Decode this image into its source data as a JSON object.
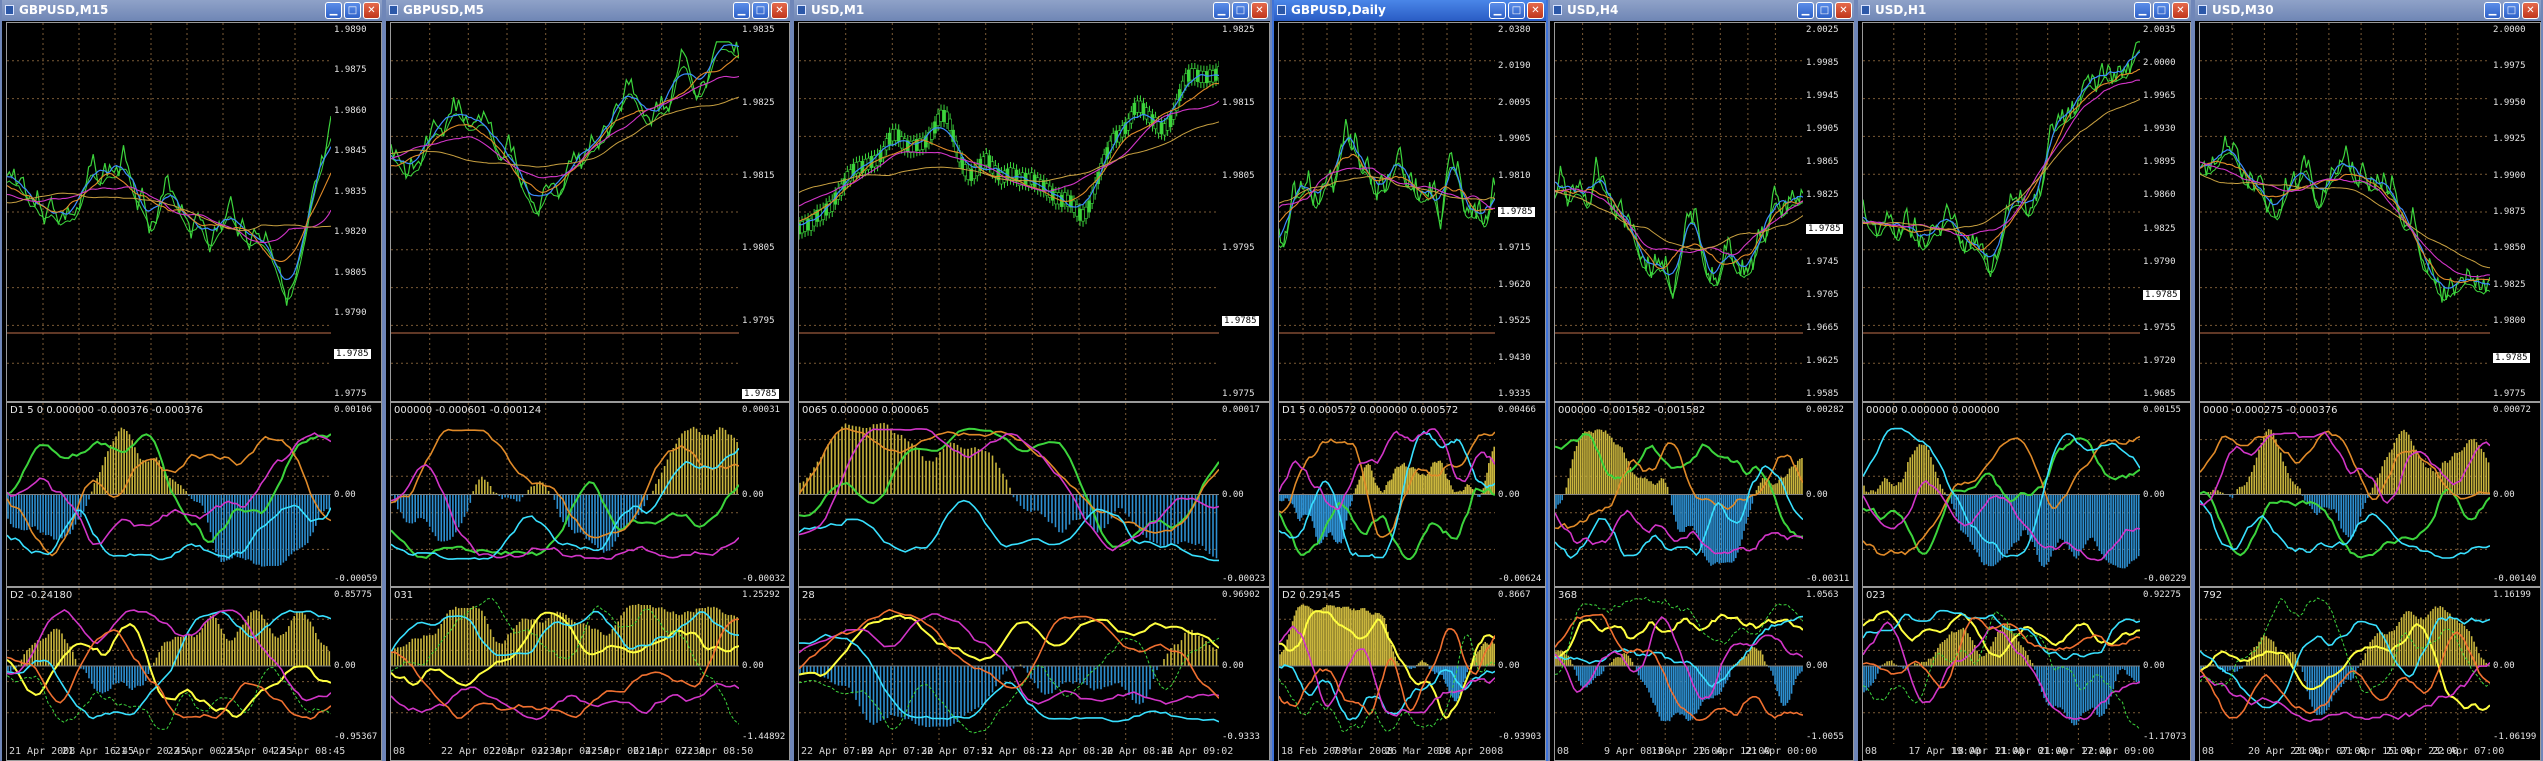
{
  "colors": {
    "title_active": "#2a5cc4",
    "title_inactive": "#7088b8",
    "grid": "#7a5a36",
    "line_green": "#3cd43c",
    "line_magenta": "#d235c8",
    "line_orange": "#e08a28",
    "line_blue": "#3c8cff",
    "line_cyan": "#38e0ff",
    "line_yellow": "#ffff40",
    "hist_olive": "#c9b53d",
    "hist_blue": "#2d8fd1"
  },
  "title_buttons": {
    "minimize": "▁",
    "maximize": "□",
    "close": "✕"
  },
  "windows": [
    {
      "title": "GBPUSD,M15",
      "active": false,
      "main_prices": [
        "1.9890",
        "1.9875",
        "1.9860",
        "1.9845",
        "1.9835",
        "1.9820",
        "1.9805",
        "1.9790",
        "1.9785",
        "1.9775"
      ],
      "mid_label": "D1 5 0 0.000000 -0.000376 -0.000376",
      "mid_prices": [
        "0.00106",
        "0.00",
        "-0.00059"
      ],
      "low_label": "D2 -0.24180",
      "low_prices": [
        "0.85775",
        "0.00",
        "-0.95367"
      ],
      "time_labels": [
        "21 Apr 2008",
        "21 Apr 16:45",
        "21 Apr 20:45",
        "22 Apr 00:45",
        "22 Apr 04:45",
        "22 Apr 08:45"
      ]
    },
    {
      "title": "GBPUSD,M5",
      "active": false,
      "main_prices": [
        "1.9835",
        "1.9825",
        "1.9815",
        "1.9805",
        "1.9795",
        "1.9785"
      ],
      "mid_label": "000000 -0.000601 -0.000124",
      "mid_prices": [
        "0.00031",
        "0.00",
        "-0.00032"
      ],
      "low_label": "031",
      "low_prices": [
        "1.25292",
        "0.00",
        "-1.44892"
      ],
      "time_labels": [
        "08",
        "22 Apr 02:05",
        "22 Apr 03:30",
        "22 Apr 04:50",
        "22 Apr 06:10",
        "22 Apr 07:30",
        "22 Apr 08:50"
      ]
    },
    {
      "title": "USD,M1",
      "active": false,
      "main_prices": [
        "1.9825",
        "1.9815",
        "1.9805",
        "1.9795",
        "1.9785",
        "1.9775"
      ],
      "mid_label": "0065 0.000000 0.000065",
      "mid_prices": [
        "0.00017",
        "0.00",
        "-0.00023"
      ],
      "low_label": "28",
      "low_prices": [
        "0.96902",
        "0.00",
        "-0.9333"
      ],
      "time_labels": [
        "22 Apr 07:09",
        "22 Apr 07:30",
        "22 Apr 07:51",
        "22 Apr 08:13",
        "22 Apr 08:30",
        "22 Apr 08:46",
        "22 Apr 09:02"
      ]
    },
    {
      "title": "GBPUSD,Daily",
      "active": true,
      "main_prices": [
        "2.0380",
        "2.0190",
        "2.0095",
        "1.9905",
        "1.9810",
        "1.9785",
        "1.9715",
        "1.9620",
        "1.9525",
        "1.9430",
        "1.9335"
      ],
      "mid_label": "D1 5 0.000572 0.000000 0.000572",
      "mid_prices": [
        "0.00466",
        "0.00",
        "-0.00624"
      ],
      "low_label": "D2 0.29145",
      "low_prices": [
        "0.8667",
        "0.00",
        "-0.93903"
      ],
      "time_labels": [
        "18 Feb 2008",
        "7 Mar 2008",
        "26 Mar 2008",
        "14 Apr 2008"
      ]
    },
    {
      "title": "USD,H4",
      "active": false,
      "main_prices": [
        "2.0025",
        "1.9985",
        "1.9945",
        "1.9905",
        "1.9865",
        "1.9825",
        "1.9785",
        "1.9745",
        "1.9705",
        "1.9665",
        "1.9625",
        "1.9585"
      ],
      "mid_label": "000000 -0.001582 -0.001582",
      "mid_prices": [
        "0.00282",
        "0.00",
        "-0.00311"
      ],
      "low_label": "368",
      "low_prices": [
        "1.0563",
        "0.00",
        "-1.0055"
      ],
      "time_labels": [
        "08",
        "9 Apr 08:00",
        "13 Apr 22:00",
        "16 Apr 12:00",
        "21 Apr 00:00"
      ]
    },
    {
      "title": "USD,H1",
      "active": false,
      "main_prices": [
        "2.0035",
        "2.0000",
        "1.9965",
        "1.9930",
        "1.9895",
        "1.9860",
        "1.9825",
        "1.9790",
        "1.9785",
        "1.9755",
        "1.9720",
        "1.9685"
      ],
      "mid_label": "00000 0.000000 0.000000",
      "mid_prices": [
        "0.00155",
        "0.00",
        "-0.00229"
      ],
      "low_label": "023",
      "low_prices": [
        "0.92275",
        "0.00",
        "-1.17073"
      ],
      "time_labels": [
        "08",
        "17 Apr 19:00",
        "18 Apr 11:00",
        "21 Apr 01:00",
        "21 Apr 17:00",
        "22 Apr 09:00"
      ]
    },
    {
      "title": "USD,M30",
      "active": false,
      "main_prices": [
        "2.0000",
        "1.9975",
        "1.9950",
        "1.9925",
        "1.9900",
        "1.9875",
        "1.9850",
        "1.9825",
        "1.9800",
        "1.9785",
        "1.9775"
      ],
      "mid_label": "0000 -0.000275 -0.000376",
      "mid_prices": [
        "0.00072",
        "0.00",
        "-0.00140"
      ],
      "low_label": "792",
      "low_prices": [
        "1.16199",
        "0.00",
        "-1.06199"
      ],
      "time_labels": [
        "08",
        "20 Apr 23:00",
        "21 Apr 07:00",
        "21 Apr 15:00",
        "21 Apr 23:00",
        "22 Apr 07:00"
      ]
    }
  ]
}
